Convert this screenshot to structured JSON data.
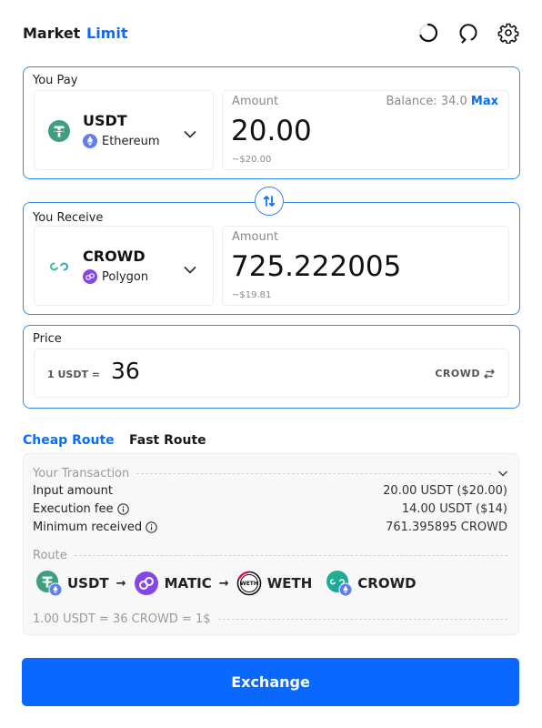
{
  "header": {
    "tabs": [
      {
        "label": "Market",
        "active": false
      },
      {
        "label": "Limit",
        "active": true
      }
    ],
    "icons": [
      "loading-spinner-icon",
      "refresh-icon",
      "settings-gear-icon"
    ]
  },
  "colors": {
    "accent": "#0a6cff",
    "panel_border": "#3b87f0",
    "button_bg": "#0a68ff",
    "muted_text": "#8a8a8a",
    "card_bg": "#f8f8f8",
    "usdt": "#3f9e7f",
    "ethereum": "#627eea",
    "polygon": "#8247e5",
    "crowd_gradient": [
      "#28c98a",
      "#2aa6c7"
    ],
    "weth_ring": "#e8005c"
  },
  "pay": {
    "label": "You Pay",
    "token_symbol": "USDT",
    "token_icon": "usdt-tether-icon",
    "chain_name": "Ethereum",
    "chain_icon": "ethereum-icon",
    "amount_label": "Amount",
    "balance_label": "Balance: 34.0",
    "max_label": "Max",
    "amount_value": "20.00",
    "amount_usd": "~$20.00"
  },
  "swap_direction_icon": "swap-vertical-arrows-icon",
  "receive": {
    "label": "You Receive",
    "token_symbol": "CROWD",
    "token_icon": "crowd-infinity-icon",
    "chain_name": "Polygon",
    "chain_icon": "polygon-icon",
    "amount_label": "Amount",
    "amount_value": "725.222005",
    "amount_usd": "~$19.81"
  },
  "price": {
    "label": "Price",
    "prefix": "1 USDT =",
    "value": "36",
    "unit": "CROWD",
    "unit_icon": "swap-horizontal-arrows-icon"
  },
  "routes": {
    "tabs": [
      {
        "label": "Cheap Route",
        "active": true
      },
      {
        "label": "Fast Route",
        "active": false
      }
    ]
  },
  "transaction": {
    "title": "Your Transaction",
    "rows": [
      {
        "label": "Input amount",
        "value": "20.00 USDT ($20.00)",
        "info": false
      },
      {
        "label": "Execution fee",
        "value": "14.00 USDT ($14)",
        "info": true
      },
      {
        "label": "Minimum received",
        "value": "761.395895 CROWD",
        "info": true
      }
    ],
    "route_title": "Route",
    "route_path": [
      {
        "symbol": "USDT",
        "icon": "usdt-on-ethereum-icon"
      },
      {
        "symbol": "MATIC",
        "icon": "matic-polygon-icon"
      },
      {
        "symbol": "WETH",
        "icon": "weth-icon"
      },
      {
        "symbol": "CROWD",
        "icon": "crowd-on-ethereum-icon"
      }
    ],
    "arrow": "→",
    "rate_summary": "1.00 USDT = 36 CROWD = 1$"
  },
  "actions": {
    "exchange_label": "Exchange"
  }
}
